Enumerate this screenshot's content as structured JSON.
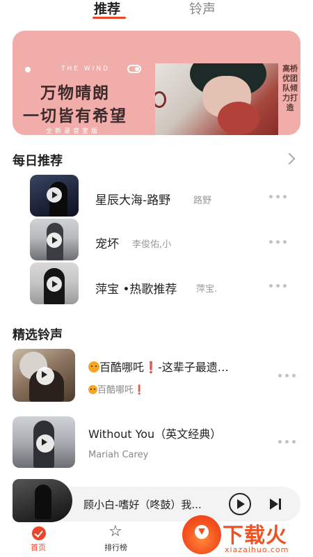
{
  "tabs": {
    "recommend": "推荐",
    "ringtone": "铃声"
  },
  "banner": {
    "tagline": "THE WIND",
    "line1": "万物晴朗",
    "line2": "一切皆有希望",
    "sub": "全新录音室版",
    "vertical": "高桥优团队倾力打造"
  },
  "daily": {
    "title": "每日推荐",
    "items": [
      {
        "title": "星辰大海-路野",
        "artist": "路野"
      },
      {
        "title": "宠坏",
        "artist": "李俊佑,小"
      },
      {
        "title": "萍宝 •热歌推荐",
        "artist": "萍宝."
      }
    ]
  },
  "featured": {
    "title": "精选铃声",
    "items": [
      {
        "title": "百酷哪吒",
        "title_rest": "-这辈子最遗…",
        "artist": "百酷哪吒"
      },
      {
        "title": "Without You（英文经典）",
        "artist": "Mariah Carey"
      }
    ]
  },
  "player": {
    "title": "顾小白-嗜好（咚鼓）我..."
  },
  "nav": {
    "home": "首页",
    "rank": "排行榜"
  },
  "watermark": {
    "title": "下载火",
    "url": "xiazaihuo.com"
  },
  "colors": {
    "accent": "#e8472c",
    "banner_bg": "#f0adaa",
    "watermark": "#ef5123"
  }
}
